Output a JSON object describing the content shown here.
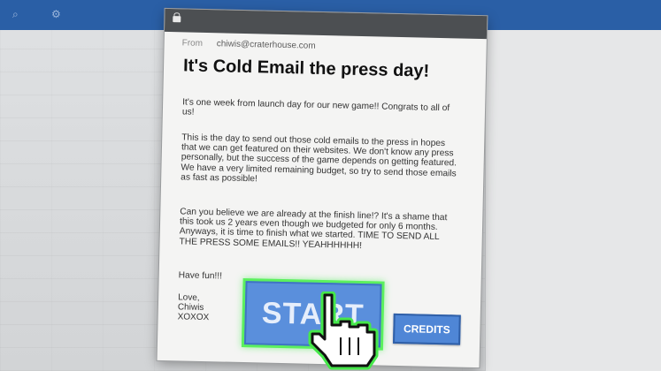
{
  "email": {
    "from_label": "From",
    "from_address": "chiwis@craterhouse.com",
    "subject": "It's Cold Email the press day!",
    "paragraphs": [
      "It's one week from launch day for our new game!! Congrats to all of us!",
      "This is the day to send out those cold emails to the press in hopes that we can get featured on their websites. We don't know any press personally, but the success of the game depends on getting featured. We have a very limited remaining budget, so try to send those emails as fast as possible!",
      "Can you believe we are already at the finish line!? It's a shame that this took us 2 years even though we budgeted for only 6 months. Anyways, it is time to finish what we started. TIME TO SEND ALL THE PRESS SOME EMAILS!! YEAHHHHHH!",
      "Have fun!!!"
    ],
    "signoff": [
      "Love,",
      "Chiwis",
      "XOXOX"
    ]
  },
  "buttons": {
    "start_label": "START",
    "credits_label": "CREDITS"
  },
  "colors": {
    "start_button": "#5a8fdc",
    "highlight": "#5bf05e",
    "credits_button": "#4f86d6",
    "titlebar": "#4c4f52",
    "browser_bar": "#2a5fa6"
  },
  "icons": {
    "titlebar": "lock-icon",
    "cursor": "hand-pointer-icon"
  }
}
